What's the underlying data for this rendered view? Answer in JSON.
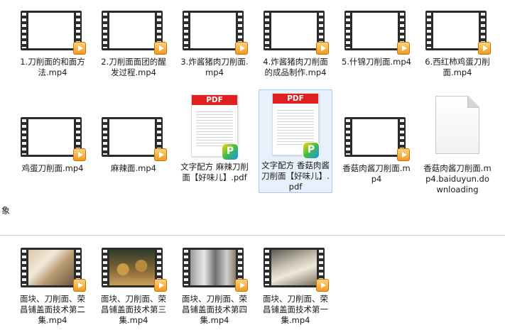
{
  "top_files": [
    {
      "name": "1.刀削面的和面方法.mp4",
      "kind": "video"
    },
    {
      "name": "2.刀削面面团的醒发过程.mp4",
      "kind": "video"
    },
    {
      "name": "3.炸酱猪肉刀削面.mp4",
      "kind": "video"
    },
    {
      "name": "4.炸酱猪肉刀削面的成品制作.mp4",
      "kind": "video"
    },
    {
      "name": "5.什锦刀削面.mp4",
      "kind": "video"
    },
    {
      "name": "6.西红柿鸡蛋刀削面.mp4",
      "kind": "video"
    },
    {
      "name": "鸡蛋刀削面.mp4",
      "kind": "video"
    },
    {
      "name": "麻辣面.mp4",
      "kind": "video"
    },
    {
      "name": "文字配方 麻辣刀削面【好味儿】.pdf",
      "kind": "pdf"
    },
    {
      "name": "文字配方 香菇肉酱刀削面【好味儿】.pdf",
      "kind": "pdf",
      "selected": true
    },
    {
      "name": "香菇肉酱刀削面.mp4",
      "kind": "video"
    },
    {
      "name": "香菇肉酱刀削面.mp4.baiduyun.downloading",
      "kind": "download"
    }
  ],
  "gap_label": "象",
  "bottom_files": [
    {
      "name": "面块、刀削面、荣昌铺盖面技术第二集.mp4",
      "kind": "video"
    },
    {
      "name": "面块、刀削面、荣昌铺盖面技术第三集.mp4",
      "kind": "video"
    },
    {
      "name": "面块、刀削面、荣昌铺盖面技术第四集.mp4",
      "kind": "video"
    },
    {
      "name": "面块、刀削面、荣昌铺盖面技术第一集.mp4",
      "kind": "video"
    }
  ],
  "pdf_badge": "PDF",
  "icons": {
    "video": "film-strip-icon",
    "play_badge": "play-icon",
    "pdf": "pdf-document-icon",
    "pdf_app": "pdf-reader-app-icon",
    "download": "blank-file-icon"
  },
  "colors": {
    "selection_bg": "#e8f1fb",
    "selection_border": "#a8c8ea",
    "pdf_red": "#e02020",
    "play_orange": "#f39a1e"
  }
}
